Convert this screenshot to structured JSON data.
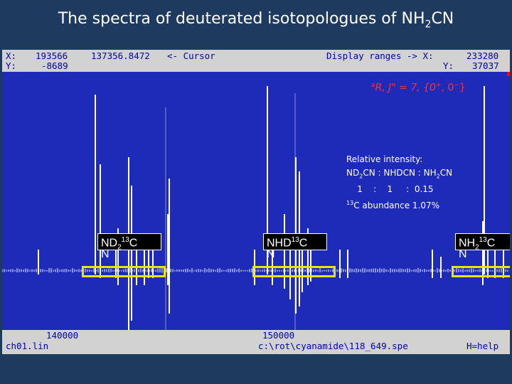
{
  "slide": {
    "title_main": "The spectra of deuterated isotopologues of NH",
    "title_sub": "2",
    "title_end": "CN"
  },
  "status_top": {
    "x_label": "X:",
    "x_value": "193566",
    "cursor_freq": "137356.8472",
    "cursor_label": "<- Cursor",
    "y_label": "Y:",
    "y_value": "-8689",
    "display_ranges": "Display ranges -> X:",
    "range_x": "233280",
    "range_y_label": "Y:",
    "range_y": "37037"
  },
  "annotation": {
    "main": "aR, J\" = 7, {0+, 0-}",
    "sup_a": "a",
    "r_text": "R, J\" = 7, {0",
    "plus": "+",
    "comma": ", 0",
    "minus": "−",
    "close": "}"
  },
  "intensity": {
    "line1": "Relative intensity:",
    "line2_a": "ND",
    "line2_sub1": "2",
    "line2_b": "CN : NHDCN : NH",
    "line2_sub2": "2",
    "line2_c": "CN",
    "line3": "    1    :    1     :  0.15",
    "line4_sup": "13",
    "line4_text": "C abundance 1.07%"
  },
  "labels": [
    {
      "a": "ND",
      "sub": "2",
      "sup": "13",
      "b": "C",
      "line2": "N"
    },
    {
      "a": "NHD",
      "sub": "",
      "sup": "13",
      "b": "C",
      "line2": "N"
    },
    {
      "a": "NH",
      "sub": "2",
      "sup": "13",
      "b": "C",
      "line2": "N"
    }
  ],
  "status_bottom": {
    "tick1": "140000",
    "tick2": "150000",
    "file_left": "ch01.lin",
    "file_path": "c:\\rot\\cyanamide\\118_649.spe",
    "help": "H=help"
  },
  "colors": {
    "plot_bg": "#1e2bb8",
    "status_bg": "#d2d2d2",
    "status_text": "#0000aa",
    "annotation": "#ff3030",
    "highlight": "#e6e600"
  },
  "chart_data": {
    "type": "line",
    "xlim": [
      137357,
      233280
    ],
    "ylim": [
      -8689,
      37037
    ],
    "x_ticks": [
      140000,
      150000
    ]
  }
}
